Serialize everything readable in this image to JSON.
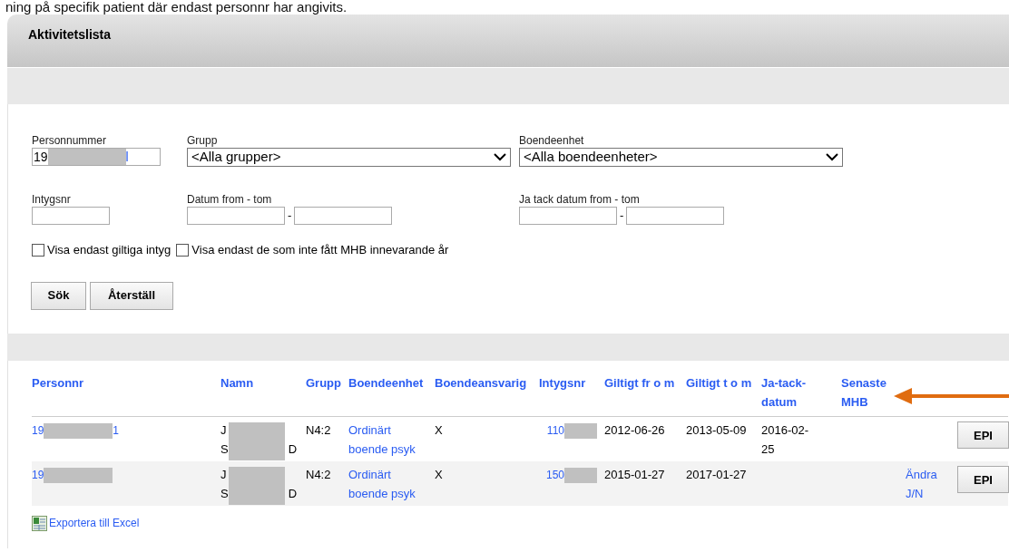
{
  "caption": "ning på specifik patient där endast personnr har angivits.",
  "panel_title": "Aktivitetslista",
  "filters": {
    "personnummer": {
      "label": "Personnummer",
      "value_start": "19",
      "value_end": "l"
    },
    "grupp": {
      "label": "Grupp",
      "value": "<Alla grupper>"
    },
    "boendeenhet": {
      "label": "Boendeenhet",
      "value": "<Alla boendeenheter>"
    },
    "intygsnr": {
      "label": "Intygsnr"
    },
    "datum": {
      "label": "Datum from - tom",
      "separator": "-"
    },
    "ja_tack_datum": {
      "label": "Ja tack datum from - tom",
      "separator": "-"
    }
  },
  "checkboxes": [
    {
      "label": "Visa endast giltiga intyg",
      "checked": false
    },
    {
      "label": "Visa endast de som inte fått MHB innevarande år",
      "checked": false
    }
  ],
  "buttons": [
    "Sök",
    "Återställ"
  ],
  "table": {
    "columns": [
      "Personnr",
      "Namn",
      "Grupp",
      "Boendeenhet",
      "Boendeansvarig",
      "Intygsnr",
      "Giltigt fr o m",
      "Giltigt t o m",
      "Ja-tack-datum",
      "Senaste MHB"
    ],
    "rows": [
      {
        "personnr_start": "19",
        "personnr_end": "1",
        "name_line1": "J",
        "name_line2": "S",
        "name_end": "D",
        "grupp": "N4:2",
        "boendeenhet": "Ordinärt boende psyk",
        "boendeansvarig": "X",
        "intygsnr": "110",
        "giltigt_from": "2012-06-26",
        "giltigt_tom": "2013-05-09",
        "ja_tack_datum": "2016-02-25",
        "edit_link": null,
        "action": "EPI"
      },
      {
        "personnr_start": "19",
        "personnr_end": "",
        "name_line1": "J",
        "name_line2": "S",
        "name_end": "D",
        "grupp": "N4:2",
        "boendeenhet": "Ordinärt boende psyk",
        "boendeansvarig": "X",
        "intygsnr": "150",
        "giltigt_from": "2015-01-27",
        "giltigt_tom": "2017-01-27",
        "ja_tack_datum": null,
        "edit_link": "Ändra J/N",
        "action": "EPI"
      }
    ]
  },
  "export_link": "Exportera till Excel"
}
